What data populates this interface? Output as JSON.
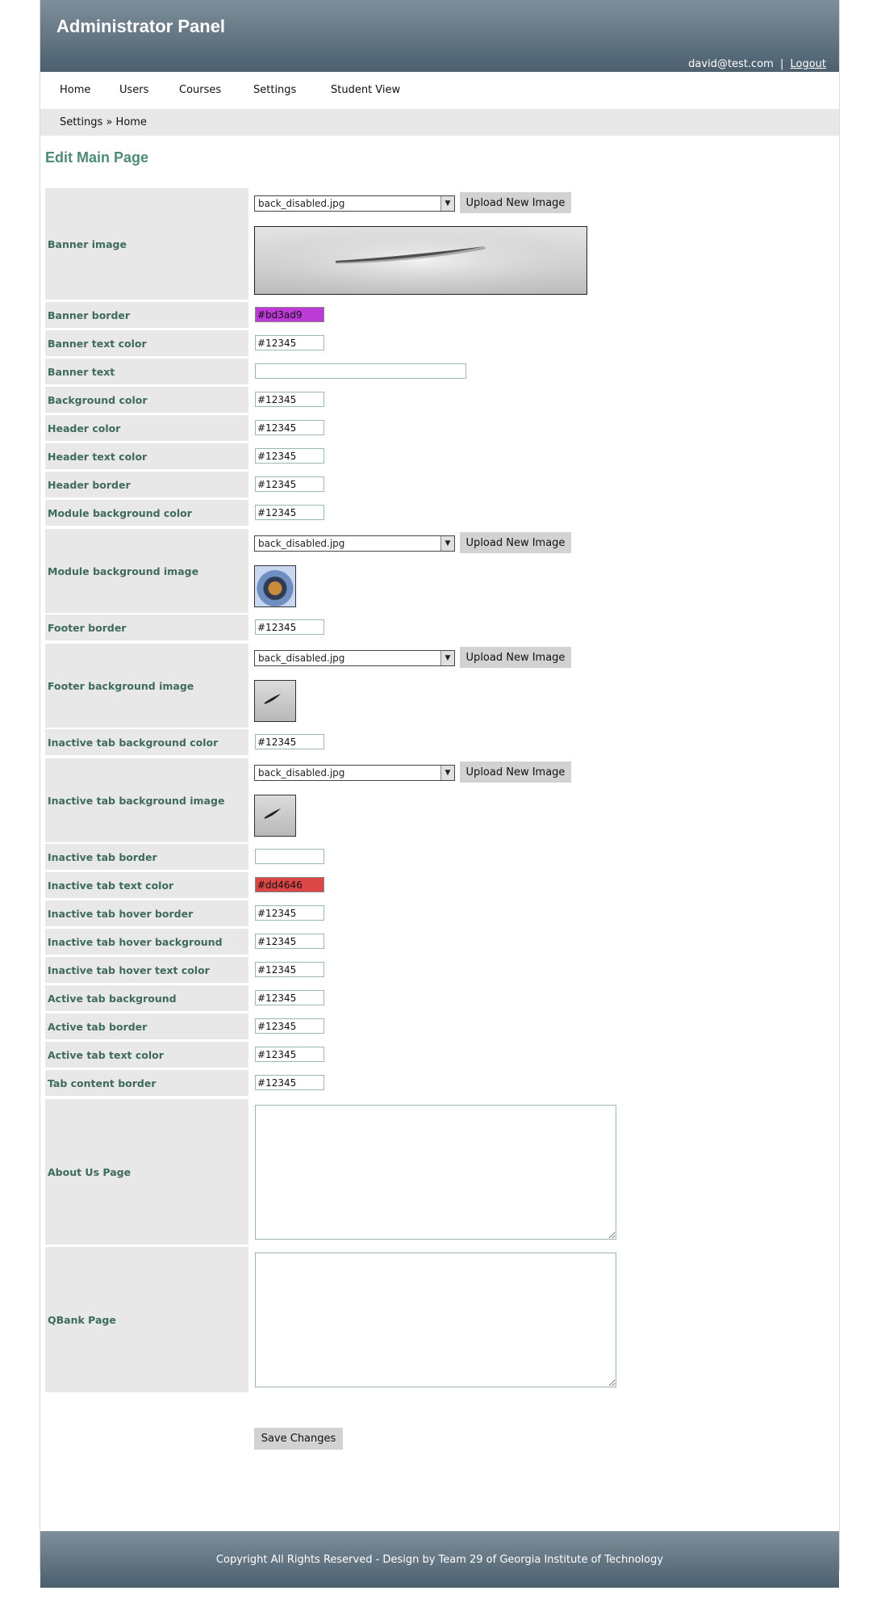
{
  "header": {
    "title": "Administrator Panel",
    "user_email": "david@test.com",
    "separator": "|",
    "logout_label": "Logout"
  },
  "nav": {
    "items": [
      {
        "label": "Home"
      },
      {
        "label": "Users"
      },
      {
        "label": "Courses"
      },
      {
        "label": "Settings"
      },
      {
        "label": "Student View"
      }
    ]
  },
  "breadcrumb": {
    "text": "Settings » Home"
  },
  "page": {
    "title": "Edit Main Page"
  },
  "form": {
    "banner_image": {
      "label": "Banner image",
      "selected": "back_disabled.jpg",
      "upload_label": "Upload New Image"
    },
    "banner_border": {
      "label": "Banner border",
      "value": "#bd3ad9",
      "swatch": "#bd3ad9"
    },
    "banner_text_color": {
      "label": "Banner text color",
      "value": "#12345"
    },
    "banner_text": {
      "label": "Banner text",
      "value": ""
    },
    "background_color": {
      "label": "Background color",
      "value": "#12345"
    },
    "header_color": {
      "label": "Header color",
      "value": "#12345"
    },
    "header_text_color": {
      "label": "Header text color",
      "value": "#12345"
    },
    "header_border": {
      "label": "Header border",
      "value": "#12345"
    },
    "module_background_color": {
      "label": "Module background color",
      "value": "#12345"
    },
    "module_background_image": {
      "label": "Module background image",
      "selected": "back_disabled.jpg",
      "upload_label": "Upload New Image"
    },
    "footer_border": {
      "label": "Footer border",
      "value": "#12345"
    },
    "footer_background_image": {
      "label": "Footer background image",
      "selected": "back_disabled.jpg",
      "upload_label": "Upload New Image"
    },
    "inactive_tab_background_color": {
      "label": "Inactive tab background color",
      "value": "#12345"
    },
    "inactive_tab_background_image": {
      "label": "Inactive tab background image",
      "selected": "back_disabled.jpg",
      "upload_label": "Upload New Image"
    },
    "inactive_tab_border": {
      "label": "Inactive tab border",
      "value": ""
    },
    "inactive_tab_text_color": {
      "label": "Inactive tab text color",
      "value": "#dd4646",
      "swatch": "#dd4646"
    },
    "inactive_tab_hover_border": {
      "label": "Inactive tab hover border",
      "value": "#12345"
    },
    "inactive_tab_hover_background": {
      "label": "Inactive tab hover background",
      "value": "#12345"
    },
    "inactive_tab_hover_text_color": {
      "label": "Inactive tab hover text color",
      "value": "#12345"
    },
    "active_tab_background": {
      "label": "Active tab background",
      "value": "#12345"
    },
    "active_tab_border": {
      "label": "Active tab border",
      "value": "#12345"
    },
    "active_tab_text_color": {
      "label": "Active tab text color",
      "value": "#12345"
    },
    "tab_content_border": {
      "label": "Tab content border",
      "value": "#12345"
    },
    "about_us_page": {
      "label": "About Us Page",
      "value": ""
    },
    "qbank_page": {
      "label": "QBank Page",
      "value": ""
    },
    "save_label": "Save Changes"
  },
  "footer": {
    "text": "Copyright All Rights Reserved - Design by Team 29 of Georgia Institute of Technology"
  }
}
